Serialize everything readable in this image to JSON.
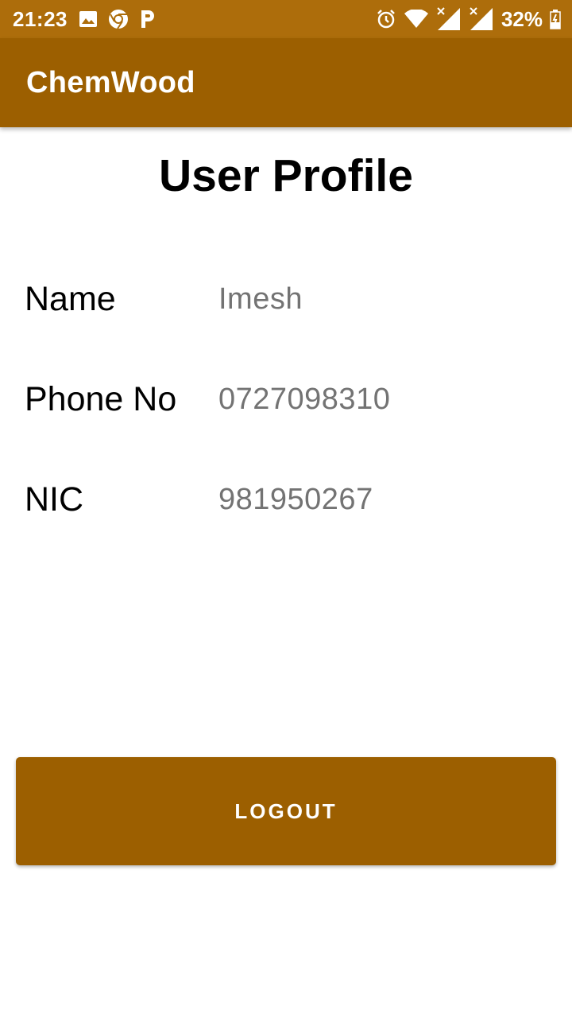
{
  "status_bar": {
    "time": "21:23",
    "battery_percent": "32%",
    "left_icons": [
      "image-icon",
      "chrome-icon",
      "p-icon"
    ],
    "right_icons": [
      "alarm-icon",
      "wifi-icon",
      "signal-icon-sim1",
      "signal-icon-sim2",
      "battery-icon"
    ],
    "background_color": "#ad6d0b"
  },
  "app_bar": {
    "title": "ChemWood",
    "background_color": "#9c5f00"
  },
  "page": {
    "title": "User Profile"
  },
  "profile": {
    "fields": [
      {
        "label": "Name",
        "value": "Imesh"
      },
      {
        "label": "Phone No",
        "value": "0727098310"
      },
      {
        "label": "NIC",
        "value": "981950267"
      }
    ]
  },
  "actions": {
    "logout_label": "LOGOUT",
    "button_color": "#9c5f00"
  }
}
